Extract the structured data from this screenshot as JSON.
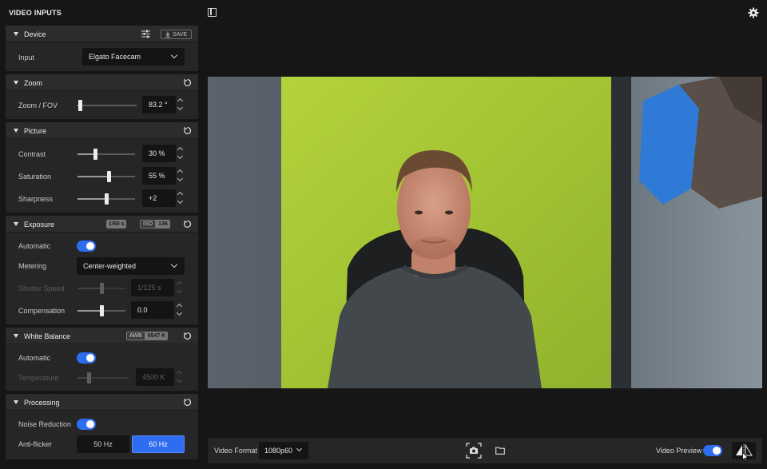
{
  "panel": {
    "title": "VIDEO INPUTS"
  },
  "device": {
    "title": "Device",
    "save_label": "SAVE",
    "input_label": "Input",
    "input_value": "Elgato Facecam"
  },
  "zoom": {
    "title": "Zoom",
    "fov_label": "Zoom / FOV",
    "fov_value": "83.2 °",
    "fov_level": 0.02
  },
  "picture": {
    "title": "Picture",
    "contrast_label": "Contrast",
    "contrast_value": "30 %",
    "contrast_level": 0.3,
    "saturation_label": "Saturation",
    "saturation_value": "55 %",
    "saturation_level": 0.55,
    "sharpness_label": "Sharpness",
    "sharpness_value": "+2",
    "sharpness_level": 0.5
  },
  "exposure": {
    "title": "Exposure",
    "badge_shutter": "1/60 s",
    "badge_iso_label": "ISO",
    "badge_iso_value": "136",
    "automatic_label": "Automatic",
    "automatic_on": true,
    "metering_label": "Metering",
    "metering_value": "Center-weighted",
    "shutter_label": "Shutter Speed",
    "shutter_value": "1/125 s",
    "shutter_level": 0.5,
    "compensation_label": "Compensation",
    "compensation_value": "0.0",
    "compensation_level": 0.5
  },
  "white_balance": {
    "title": "White Balance",
    "badge_mode": "AWB",
    "badge_value": "6547 K",
    "automatic_label": "Automatic",
    "automatic_on": true,
    "temperature_label": "Temperature",
    "temperature_value": "4500 K",
    "temperature_level": 0.2
  },
  "processing": {
    "title": "Processing",
    "noise_label": "Noise Reduction",
    "noise_on": true,
    "flicker_label": "Anti-flicker",
    "flicker_options": [
      "50 Hz",
      "60 Hz"
    ],
    "flicker_selected": "60 Hz"
  },
  "bottom": {
    "format_label": "Video Format",
    "format_value": "1080p60",
    "preview_label": "Video Preview",
    "preview_on": true
  },
  "colors": {
    "accent": "#2e6cf0",
    "panel_bg": "#262626",
    "app_bg": "#161616"
  },
  "icons": [
    "sidebar-toggle-icon",
    "gear-icon",
    "sliders-icon",
    "reset-icon",
    "camera-icon",
    "folder-icon",
    "mirror-icon",
    "chevron-down-icon"
  ]
}
